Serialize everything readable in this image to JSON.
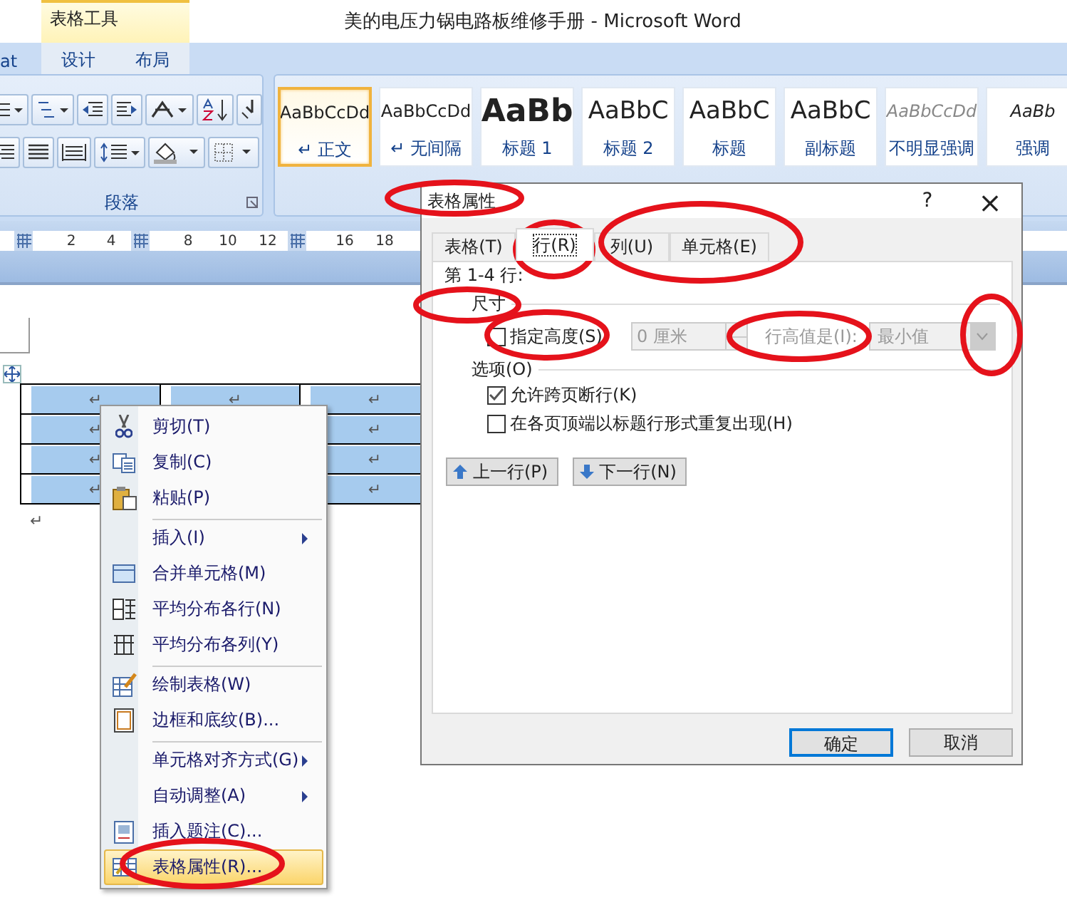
{
  "title_bar": {
    "contextual_tab": "表格工具",
    "title": "美的电压力锅电路板维修手册 - Microsoft Word"
  },
  "ribbon_tabs": [
    {
      "label": "at",
      "selected": false
    },
    {
      "label": "设计",
      "selected": false
    },
    {
      "label": "布局",
      "selected": false
    }
  ],
  "paragraph_group": {
    "label": "段落"
  },
  "styles": [
    {
      "sample": "AaBbCcDd",
      "name": "↵ 正文",
      "kind": "normal",
      "selected": true
    },
    {
      "sample": "AaBbCcDd",
      "name": "↵ 无间隔",
      "kind": "normal",
      "selected": false
    },
    {
      "sample": "AaBb",
      "name": "标题 1",
      "kind": "heading-large",
      "selected": false
    },
    {
      "sample": "AaBbC",
      "name": "标题 2",
      "kind": "heading",
      "selected": false
    },
    {
      "sample": "AaBbC",
      "name": "标题",
      "kind": "heading",
      "selected": false
    },
    {
      "sample": "AaBbC",
      "name": "副标题",
      "kind": "heading",
      "selected": false
    },
    {
      "sample": "AaBbCcDd",
      "name": "不明显强调",
      "kind": "subtle",
      "selected": false
    },
    {
      "sample": "AaBb",
      "name": "强调",
      "kind": "emphasis",
      "selected": false
    }
  ],
  "ruler": [
    {
      "kind": "marker"
    },
    {
      "kind": "number",
      "label": "2"
    },
    {
      "kind": "number",
      "label": "4"
    },
    {
      "kind": "marker"
    },
    {
      "kind": "number",
      "label": "8"
    },
    {
      "kind": "number",
      "label": "10"
    },
    {
      "kind": "number",
      "label": "12"
    },
    {
      "kind": "marker"
    },
    {
      "kind": "number",
      "label": "16"
    },
    {
      "kind": "number",
      "label": "18"
    }
  ],
  "table": {
    "rows": [
      [
        {
          "text": "↵"
        },
        {
          "text": "↵"
        },
        {
          "text": "↵"
        }
      ],
      [
        {
          "text": "↵"
        },
        {},
        {
          "text": "↵"
        }
      ],
      [
        {
          "text": "↵"
        },
        {},
        {
          "text": "↵"
        }
      ],
      [
        {
          "text": "↵"
        },
        {},
        {
          "text": "↵"
        }
      ]
    ]
  },
  "paragraph_mark": "↵",
  "context_menu": [
    {
      "label": "剪切(T)",
      "submenu": false,
      "group_start": false,
      "selected": false
    },
    {
      "label": "复制(C)",
      "submenu": false,
      "group_start": false,
      "selected": false
    },
    {
      "label": "粘贴(P)",
      "submenu": false,
      "group_start": false,
      "selected": false
    },
    {
      "label": "插入(I)",
      "submenu": true,
      "group_start": true,
      "selected": false
    },
    {
      "label": "合并单元格(M)",
      "submenu": false,
      "group_start": false,
      "selected": false
    },
    {
      "label": "平均分布各行(N)",
      "submenu": false,
      "group_start": false,
      "selected": false
    },
    {
      "label": "平均分布各列(Y)",
      "submenu": false,
      "group_start": false,
      "selected": false
    },
    {
      "label": "绘制表格(W)",
      "submenu": false,
      "group_start": true,
      "selected": false
    },
    {
      "label": "边框和底纹(B)...",
      "submenu": false,
      "group_start": false,
      "selected": false
    },
    {
      "label": "单元格对齐方式(G)",
      "submenu": true,
      "group_start": true,
      "selected": false
    },
    {
      "label": "自动调整(A)",
      "submenu": true,
      "group_start": false,
      "selected": false
    },
    {
      "label": "插入题注(C)...",
      "submenu": false,
      "group_start": false,
      "selected": false
    },
    {
      "label": "表格属性(R)...",
      "submenu": false,
      "group_start": false,
      "selected": true
    }
  ],
  "dialog": {
    "title": "表格属性",
    "help": "?",
    "close": "×",
    "tabs": [
      {
        "label": "表格(T)",
        "selected": false
      },
      {
        "label": "行(R)",
        "selected": true
      },
      {
        "label": "列(U)",
        "selected": false
      },
      {
        "label": "单元格(E)",
        "selected": false
      }
    ],
    "row_range": "第 1-4 行:",
    "size_section": "尺寸",
    "specify_height": {
      "label": "指定高度(S)",
      "checked": false
    },
    "height_value": "0 厘米",
    "height_rule_label": "行高值是(I):",
    "height_rule_value": "最小值",
    "height_disabled": true,
    "options_section": "选项(O)",
    "options": [
      {
        "label": "允许跨页断行(K)",
        "checked": true
      },
      {
        "label": "在各页顶端以标题行形式重复出现(H)",
        "checked": false
      }
    ],
    "nav_buttons": [
      {
        "label": "上一行(P)",
        "kind": "up"
      },
      {
        "label": "下一行(N)",
        "kind": "down"
      }
    ],
    "buttons": [
      {
        "label": "确定",
        "default": true
      },
      {
        "label": "取消",
        "default": false
      }
    ]
  }
}
